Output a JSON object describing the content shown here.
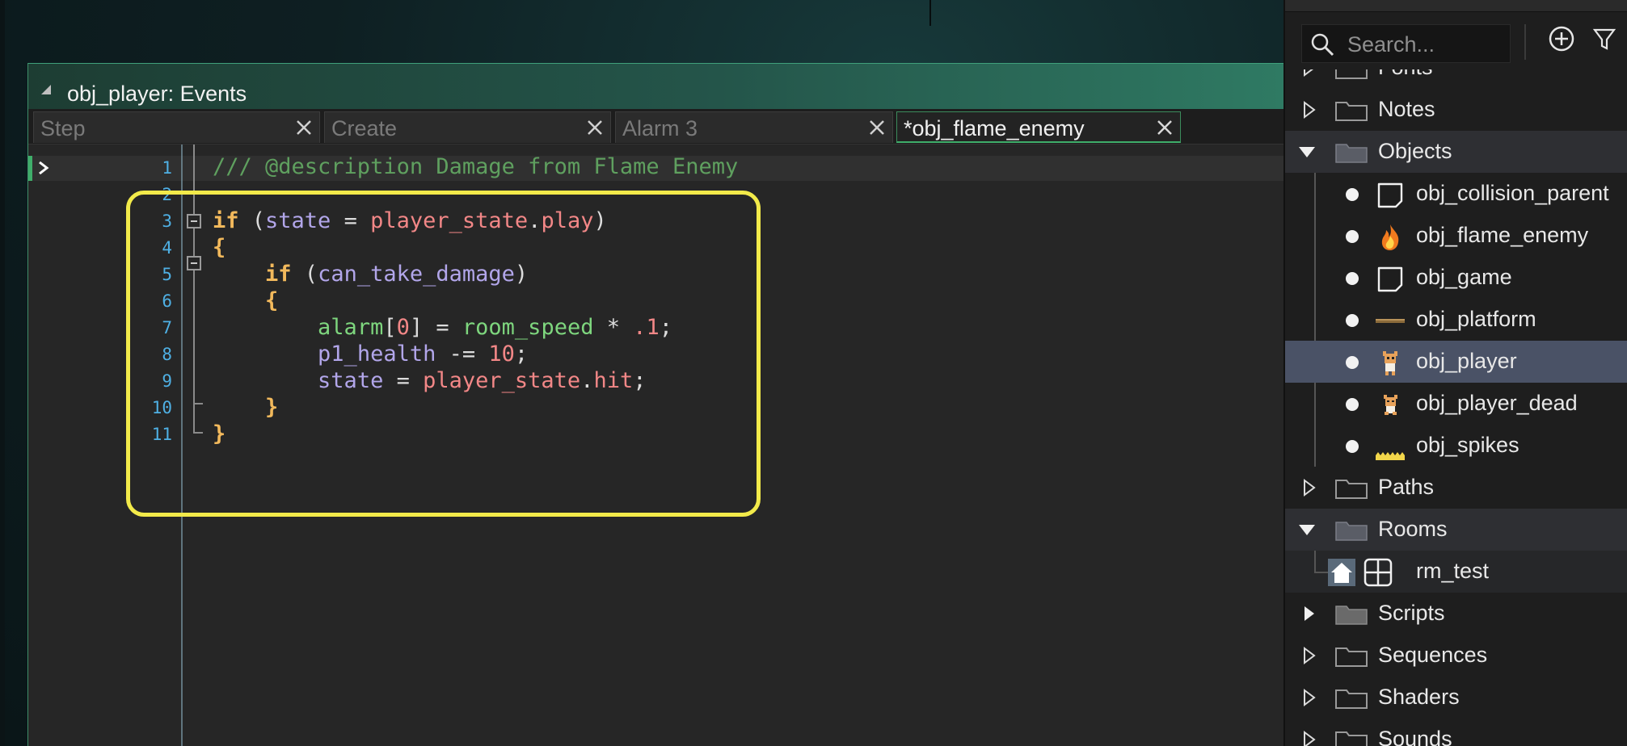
{
  "window": {
    "title": "obj_player: Events"
  },
  "tabs": [
    {
      "label": "Step",
      "active": false
    },
    {
      "label": "Create",
      "active": false
    },
    {
      "label": "Alarm 3",
      "active": false
    },
    {
      "label": "*obj_flame_enemy",
      "active": true
    }
  ],
  "editor": {
    "line_numbers": [
      "1",
      "2",
      "3",
      "4",
      "5",
      "6",
      "7",
      "8",
      "9",
      "10",
      "11"
    ],
    "code": {
      "l1": "/// @description Damage from Flame Enemy",
      "l3": {
        "kw": "if",
        "p1": " (",
        "v": "state",
        "eq": " = ",
        "e1": "player_state",
        "dot": ".",
        "e2": "play",
        "p2": ")"
      },
      "l4": {
        "brace": "{"
      },
      "l5": {
        "indent": "    ",
        "kw": "if",
        "p1": " (",
        "v": "can_take_damage",
        "p2": ")"
      },
      "l6": {
        "indent": "    ",
        "brace": "{"
      },
      "l7": {
        "indent": "        ",
        "fn": "alarm",
        "b1": "[",
        "n1": "0",
        "b2": "]",
        "eq": " = ",
        "fn2": "room_speed",
        "op": " * ",
        "n2": ".1",
        "semi": ";"
      },
      "l8": {
        "indent": "        ",
        "v": "p1_health",
        "op": " -= ",
        "n": "10",
        "semi": ";"
      },
      "l9": {
        "indent": "        ",
        "v": "state",
        "eq": " = ",
        "e1": "player_state",
        "dot": ".",
        "e2": "hit",
        "semi": ";"
      },
      "l10": {
        "indent": "    ",
        "brace": "}"
      },
      "l11": {
        "brace": "}"
      }
    },
    "highlight_color": "#f2ea4a"
  },
  "asset_browser": {
    "search": {
      "placeholder": "Search..."
    },
    "items": [
      {
        "label": "Fonts",
        "kind": "group",
        "expanded": false
      },
      {
        "label": "Notes",
        "kind": "group",
        "expanded": false
      },
      {
        "label": "Objects",
        "kind": "group",
        "expanded": true
      },
      {
        "label": "obj_collision_parent",
        "kind": "object",
        "icon": "blank-sprite-icon"
      },
      {
        "label": "obj_flame_enemy",
        "kind": "object",
        "icon": "flame-icon"
      },
      {
        "label": "obj_game",
        "kind": "object",
        "icon": "blank-sprite-icon"
      },
      {
        "label": "obj_platform",
        "kind": "object",
        "icon": "platform-sprite-icon"
      },
      {
        "label": "obj_player",
        "kind": "object",
        "icon": "player-sprite-icon",
        "selected": true
      },
      {
        "label": "obj_player_dead",
        "kind": "object",
        "icon": "player-dead-sprite-icon"
      },
      {
        "label": "obj_spikes",
        "kind": "object",
        "icon": "spikes-sprite-icon"
      },
      {
        "label": "Paths",
        "kind": "group",
        "expanded": false
      },
      {
        "label": "Rooms",
        "kind": "group",
        "expanded": true
      },
      {
        "label": "rm_test",
        "kind": "room",
        "icon": "room-icon"
      },
      {
        "label": "Scripts",
        "kind": "group",
        "expanded": false
      },
      {
        "label": "Sequences",
        "kind": "group",
        "expanded": false
      },
      {
        "label": "Shaders",
        "kind": "group",
        "expanded": false
      },
      {
        "label": "Sounds",
        "kind": "group",
        "expanded": false
      }
    ]
  },
  "colors": {
    "accent_green": "#3fae6a",
    "selection": "#4a5266",
    "line_number": "#4fb0e4"
  }
}
